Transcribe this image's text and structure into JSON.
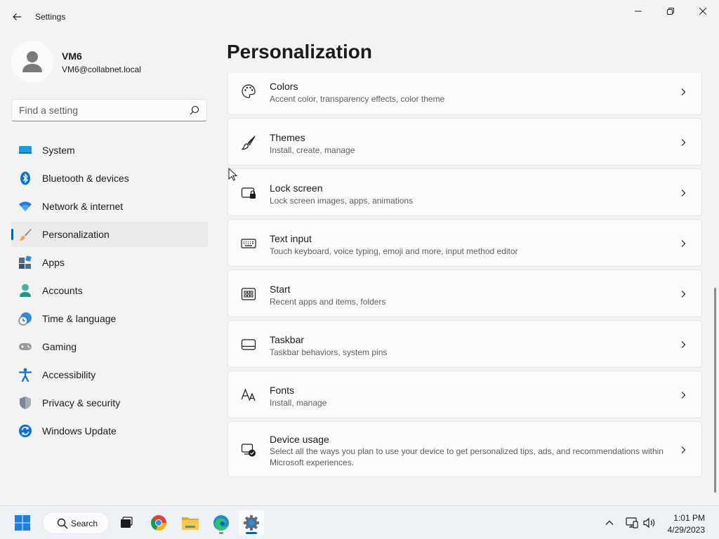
{
  "window": {
    "title": "Settings"
  },
  "user": {
    "name": "VM6",
    "email": "VM6@collabnet.local"
  },
  "search": {
    "placeholder": "Find a setting"
  },
  "nav": {
    "items": [
      {
        "label": "System",
        "icon": "system-icon",
        "active": false
      },
      {
        "label": "Bluetooth & devices",
        "icon": "bluetooth-icon",
        "active": false
      },
      {
        "label": "Network & internet",
        "icon": "wifi-icon",
        "active": false
      },
      {
        "label": "Personalization",
        "icon": "brush-icon",
        "active": true
      },
      {
        "label": "Apps",
        "icon": "apps-icon",
        "active": false
      },
      {
        "label": "Accounts",
        "icon": "accounts-icon",
        "active": false
      },
      {
        "label": "Time & language",
        "icon": "clock-globe-icon",
        "active": false
      },
      {
        "label": "Gaming",
        "icon": "gamepad-icon",
        "active": false
      },
      {
        "label": "Accessibility",
        "icon": "accessibility-icon",
        "active": false
      },
      {
        "label": "Privacy & security",
        "icon": "shield-icon",
        "active": false
      },
      {
        "label": "Windows Update",
        "icon": "update-icon",
        "active": false
      }
    ]
  },
  "main": {
    "title": "Personalization",
    "cards": [
      {
        "title": "Colors",
        "desc": "Accent color, transparency effects, color theme",
        "icon": "palette-icon"
      },
      {
        "title": "Themes",
        "desc": "Install, create, manage",
        "icon": "brush-icon"
      },
      {
        "title": "Lock screen",
        "desc": "Lock screen images, apps, animations",
        "icon": "lock-screen-icon"
      },
      {
        "title": "Text input",
        "desc": "Touch keyboard, voice typing, emoji and more, input method editor",
        "icon": "keyboard-icon"
      },
      {
        "title": "Start",
        "desc": "Recent apps and items, folders",
        "icon": "start-icon"
      },
      {
        "title": "Taskbar",
        "desc": "Taskbar behaviors, system pins",
        "icon": "taskbar-icon"
      },
      {
        "title": "Fonts",
        "desc": "Install, manage",
        "icon": "fonts-icon"
      },
      {
        "title": "Device usage",
        "desc": "Select all the ways you plan to use your device to get personalized tips, ads, and recommendations within Microsoft experiences.",
        "icon": "device-usage-icon"
      }
    ]
  },
  "taskbar": {
    "search_label": "Search",
    "time": "1:01 PM",
    "date": "4/29/2023",
    "apps": [
      "start-icon",
      "search-icon",
      "task-view-icon",
      "chrome-icon",
      "file-explorer-icon",
      "edge-icon",
      "settings-icon"
    ]
  },
  "colors": {
    "accent": "#005fb8",
    "background": "#f3f3f3",
    "card": "#fbfbfb"
  }
}
